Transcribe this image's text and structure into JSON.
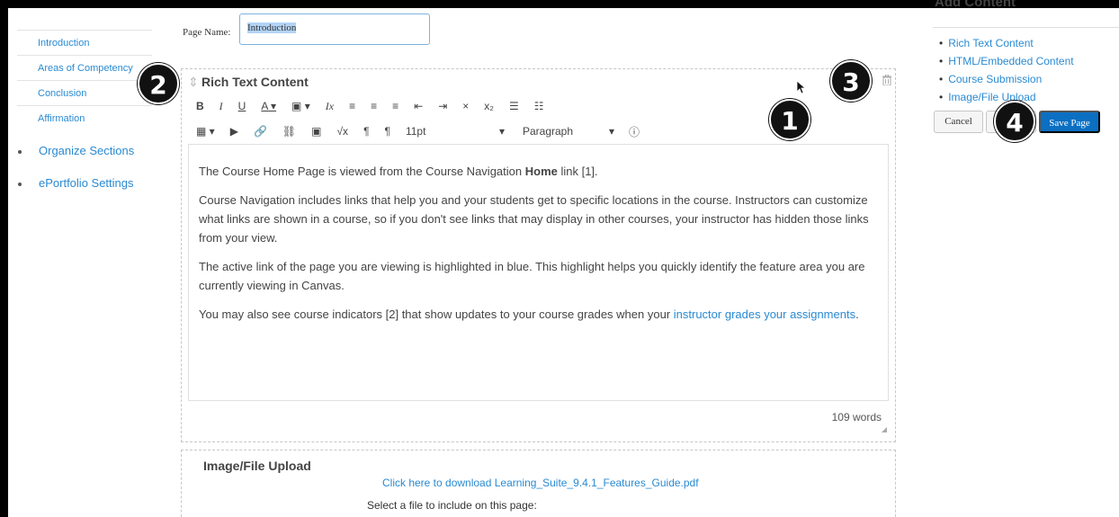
{
  "sidebar": {
    "sub_items": [
      {
        "label": "Introduction"
      },
      {
        "label": "Areas of Competency"
      },
      {
        "label": "Conclusion"
      },
      {
        "label": "Affirmation"
      }
    ],
    "main_items": [
      {
        "label": "Organize Sections"
      },
      {
        "label": "ePortfolio Settings"
      }
    ]
  },
  "page_name": {
    "label": "Page Name:",
    "value": "Introduction"
  },
  "rich_text": {
    "title": "Rich Text Content",
    "toolbar": {
      "font_size": "11pt",
      "block_format": "Paragraph",
      "dropdown_arrow": "▾"
    },
    "content": {
      "p1_before": "The Course Home Page is viewed from the Course Navigation ",
      "p1_bold": "Home",
      "p1_after": " link [1].",
      "p2": "Course Navigation includes links that help you and your students get to specific locations in the course. Instructors can customize what links are shown in a course, so if you don't see links that may display in other courses, your instructor has hidden those links from your view.",
      "p3": "The active link of the page you are viewing is highlighted in blue. This highlight helps you quickly identify the feature area you are currently viewing in Canvas.",
      "p4_before": "You may also see course indicators [2] that show updates to your course grades when your ",
      "p4_link": "instructor grades your assignments",
      "p4_after": "."
    },
    "word_count": "109 words"
  },
  "upload": {
    "title": "Image/File Upload",
    "download_link": "Click here to download Learning_Suite_9.4.1_Features_Guide.pdf",
    "select_text": "Select a file to include on this page:"
  },
  "add_content": {
    "title": "Add Content",
    "items": [
      {
        "label": "Rich Text Content"
      },
      {
        "label": "HTML/Embedded Content"
      },
      {
        "label": "Course Submission"
      },
      {
        "label": "Image/File Upload"
      }
    ]
  },
  "buttons": {
    "cancel": "Cancel",
    "save": "Save Page"
  },
  "callouts": [
    "1",
    "2",
    "3",
    "4"
  ],
  "colors": {
    "link": "#2a8ad2",
    "primary_button": "#0b6fc2",
    "callout_bg": "#111111"
  }
}
